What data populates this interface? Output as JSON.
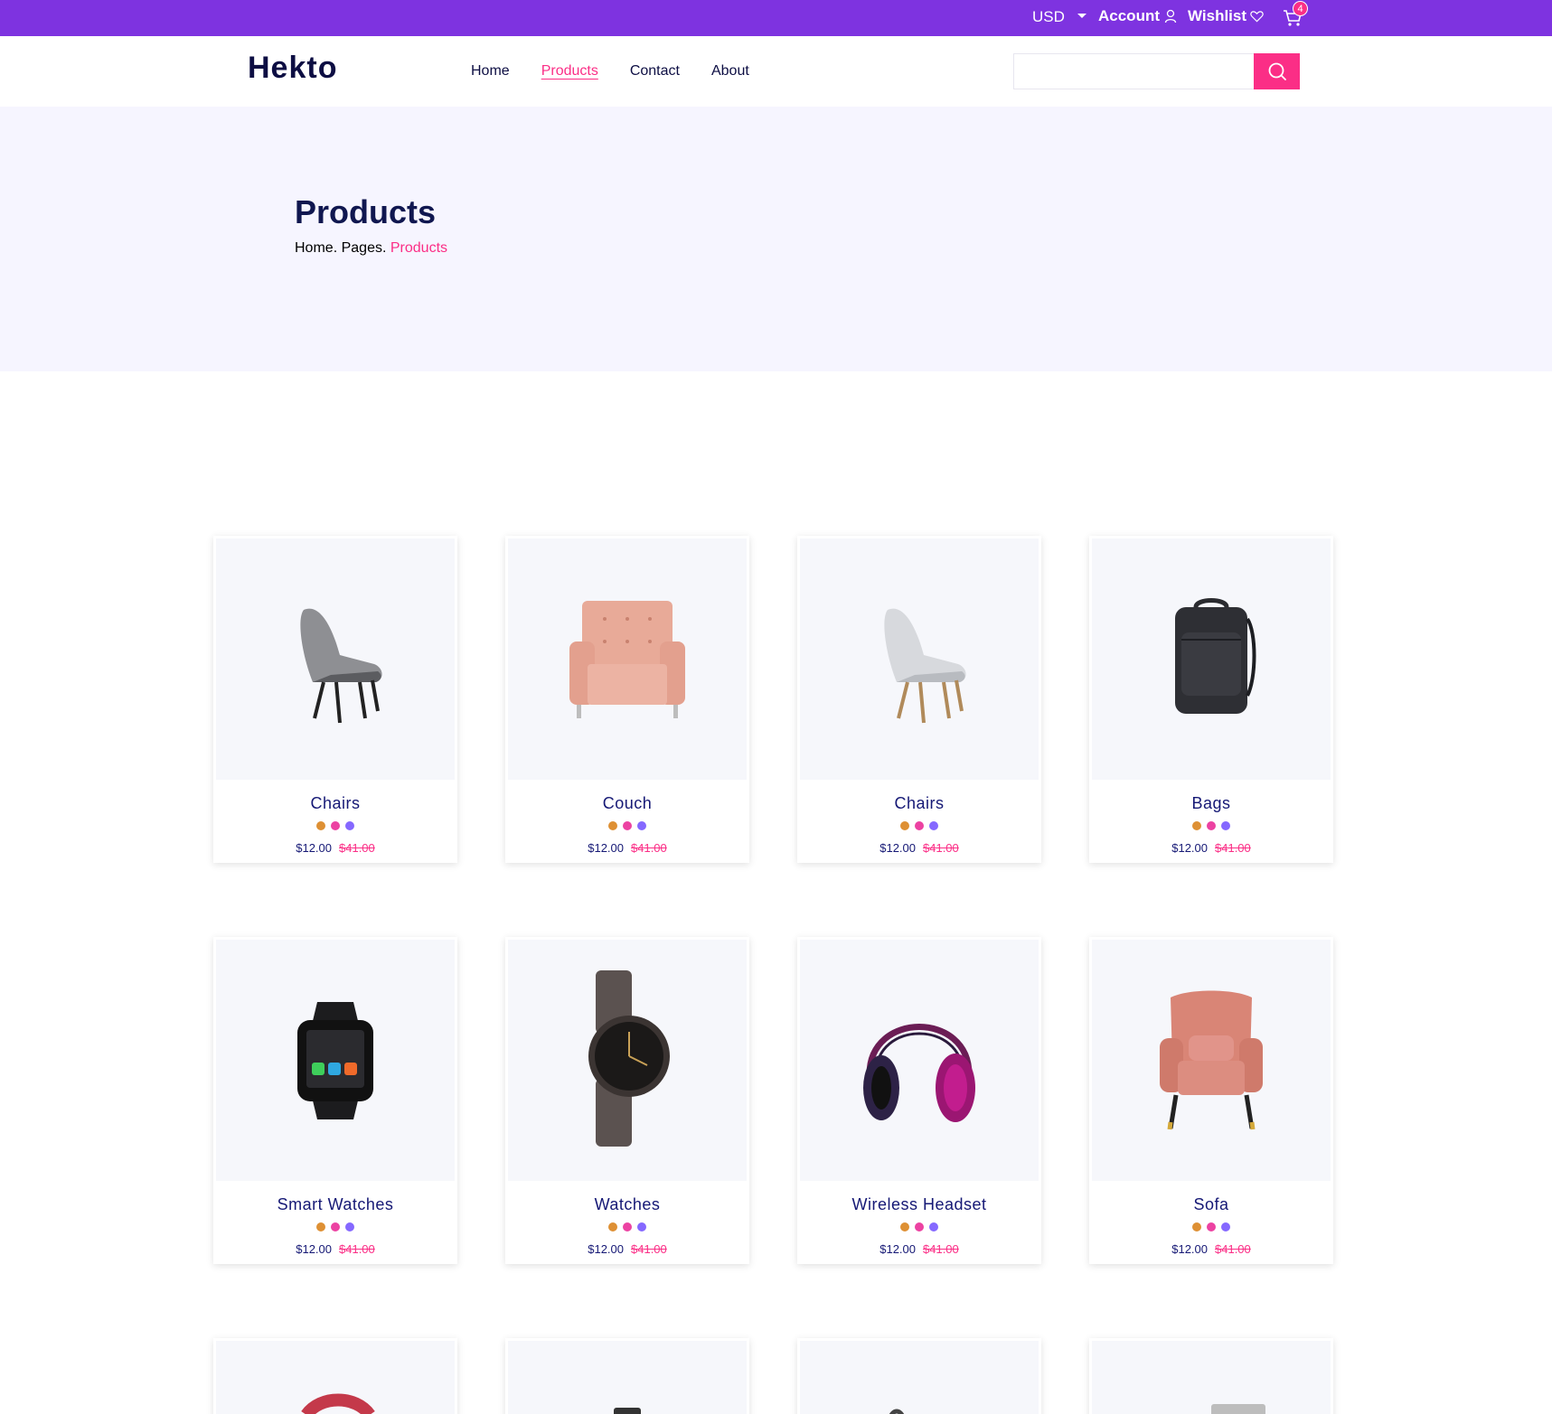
{
  "topbar": {
    "currency": "USD",
    "account_label": "Account",
    "wishlist_label": "Wishlist",
    "cart_count": "4",
    "accent_color": "#7E33E0"
  },
  "header": {
    "logo": "Hekto",
    "nav": [
      {
        "label": "Home"
      },
      {
        "label": "Products"
      },
      {
        "label": "Contact"
      },
      {
        "label": "About"
      }
    ],
    "search_placeholder": "",
    "search_button_color": "#FB2E86"
  },
  "hero": {
    "title": "Products",
    "breadcrumb": [
      "Home",
      ".",
      "Pages",
      ".",
      "Products"
    ]
  },
  "products": [
    {
      "name": "Chairs",
      "price": "$12.00",
      "old_price": "$41.00",
      "icon": "lounge-chair-grey"
    },
    {
      "name": "Couch",
      "price": "$12.00",
      "old_price": "$41.00",
      "icon": "armchair-pink"
    },
    {
      "name": "Chairs",
      "price": "$12.00",
      "old_price": "$41.00",
      "icon": "lounge-chair-white"
    },
    {
      "name": "Bags",
      "price": "$12.00",
      "old_price": "$41.00",
      "icon": "backpack"
    },
    {
      "name": "Smart Watches",
      "price": "$12.00",
      "old_price": "$41.00",
      "icon": "smartwatch"
    },
    {
      "name": "Watches",
      "price": "$12.00",
      "old_price": "$41.00",
      "icon": "wristwatch"
    },
    {
      "name": "Wireless Headset",
      "price": "$12.00",
      "old_price": "$41.00",
      "icon": "headphones"
    },
    {
      "name": "Sofa",
      "price": "$12.00",
      "old_price": "$41.00",
      "icon": "wingback-chair"
    }
  ],
  "swatch_colors": [
    "#DE9034",
    "#EC42A2",
    "#8568FF"
  ]
}
